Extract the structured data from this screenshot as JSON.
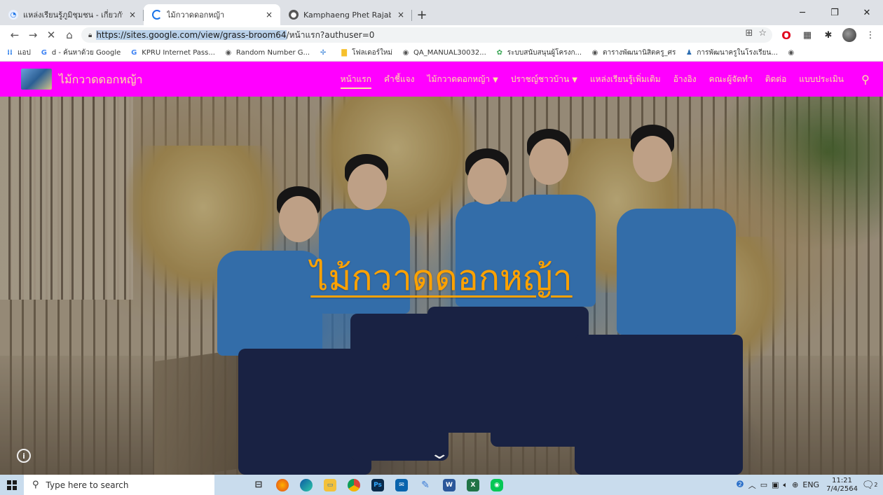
{
  "browser": {
    "tabs": [
      {
        "title": "แหล่งเรียนรู้ภูมิชุมชน - เกี่ยวกับโครงการ",
        "icon": "sites-icon"
      },
      {
        "title": "ไม้กวาดดอกหญ้า",
        "icon": "loading-icon"
      },
      {
        "title": "Kamphaeng Phet Rajabhat Unive",
        "icon": "university-icon"
      }
    ],
    "close_glyph": "×",
    "newtab_glyph": "+",
    "url_selected": "https://sites.google.com/view/grass-broom64",
    "url_rest": "/หน้าแรก?authuser=0",
    "bookmarks": [
      {
        "label": "แอป",
        "icon": "apps-grid-icon"
      },
      {
        "label": "d - ค้นหาด้วย Google",
        "icon": "google-icon"
      },
      {
        "label": "KPRU Internet Pass...",
        "icon": "google-icon"
      },
      {
        "label": "Random Number G...",
        "icon": "globe-icon"
      },
      {
        "label": "",
        "icon": "pinwheel-icon"
      },
      {
        "label": "โฟลเดอร์ใหม่",
        "icon": "folder-icon"
      },
      {
        "label": "QA_MANUAL30032...",
        "icon": "globe-icon"
      },
      {
        "label": "ระบบสนับสนุนผู้โครงก...",
        "icon": "plant-icon"
      },
      {
        "label": "ตารางพัฒนานิสิตครู_ศร",
        "icon": "globe-icon"
      },
      {
        "label": "การพัฒนาครูในโรงเรียน...",
        "icon": "person-icon"
      },
      {
        "label": "",
        "icon": "globe-icon"
      }
    ]
  },
  "site": {
    "name": "ไม้กวาดดอกหญ้า",
    "menu": [
      {
        "label": "หน้าแรก",
        "current": true
      },
      {
        "label": "คำชี้แจง"
      },
      {
        "label": "ไม้กวาดดอกหญ้า",
        "dropdown": true
      },
      {
        "label": "ปราชญ์ชาวบ้าน",
        "dropdown": true
      },
      {
        "label": "แหล่งเรียนรู้เพิ่มเติม"
      },
      {
        "label": "อ้างอิง"
      },
      {
        "label": "คณะผู้จัดทำ"
      },
      {
        "label": "ติดต่อ"
      },
      {
        "label": "แบบประเมิน"
      }
    ],
    "hero_title": "ไม้กวาดดอกหญ้า"
  },
  "taskbar": {
    "search_placeholder": "Type here to search",
    "apps": [
      "task-view",
      "firefox",
      "edge",
      "file-explorer",
      "chrome",
      "photoshop",
      "mail",
      "pen",
      "word",
      "excel",
      "line"
    ],
    "lang": "ENG",
    "time": "11:21",
    "date": "7/4/2564",
    "notif_count": "2"
  },
  "colors": {
    "site_nav_bg": "#ff00ff",
    "site_nav_text": "#fbe3a3",
    "hero_title": "#ffa200"
  }
}
